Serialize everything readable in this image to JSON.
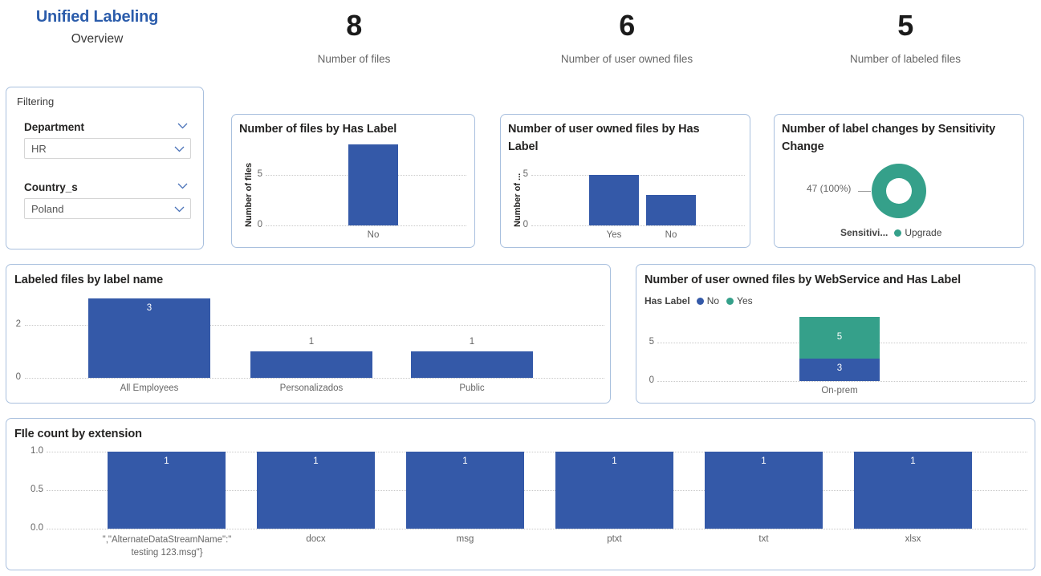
{
  "header": {
    "title": "Unified Labeling",
    "subtitle": "Overview",
    "kpis": [
      {
        "value": "8",
        "label": "Number of files"
      },
      {
        "value": "6",
        "label": "Number of user owned files"
      },
      {
        "value": "5",
        "label": "Number of labeled files"
      }
    ]
  },
  "filtering": {
    "heading": "Filtering",
    "slicers": [
      {
        "label": "Department",
        "value": "HR"
      },
      {
        "label": "Country_s",
        "value": "Poland"
      }
    ]
  },
  "colors": {
    "brand_blue": "#2b5cab",
    "bar_blue": "#3459a8",
    "teal": "#35a08a",
    "card_border": "#a9c0de",
    "gridline": "#c9c9c9",
    "muted_text": "#666666"
  },
  "chart_data": [
    {
      "id": "files_by_has_label",
      "type": "bar",
      "title": "Number of files by Has Label",
      "ylabel": "Number of files",
      "xlabel": "",
      "categories": [
        "No"
      ],
      "values": [
        8
      ],
      "ylim": [
        0,
        9
      ],
      "yticks": [
        "0",
        "5"
      ],
      "ytick_values": [
        0,
        5
      ],
      "grid": true,
      "series_color": "#3459a8",
      "show_data_labels": false
    },
    {
      "id": "user_owned_by_has_label",
      "type": "bar",
      "title": "Number of user owned files by Has Label",
      "ylabel": "Number of ...",
      "xlabel": "",
      "categories": [
        "Yes",
        "No"
      ],
      "values": [
        5,
        3
      ],
      "ylim": [
        0,
        5.6
      ],
      "yticks": [
        "0",
        "5"
      ],
      "ytick_values": [
        0,
        5
      ],
      "grid": true,
      "series_color": "#3459a8",
      "show_data_labels": false
    },
    {
      "id": "label_changes_by_sensitivity",
      "type": "pie",
      "title": "Number of label changes by Sensitivity Change",
      "legend_title": "Sensitivi...",
      "legend_position": "bottom",
      "slices": [
        {
          "name": "Upgrade",
          "value": 47,
          "percent": "100%",
          "label": "47 (100%)",
          "color": "#35a08a"
        }
      ]
    },
    {
      "id": "labeled_files_by_label_name",
      "type": "bar",
      "title": "Labeled files by label name",
      "ylabel": "",
      "xlabel": "",
      "categories": [
        "All Employees",
        "Personalizados",
        "Public"
      ],
      "values": [
        3,
        1,
        1
      ],
      "data_labels": [
        "3",
        "1",
        "1"
      ],
      "ylim": [
        0,
        3.2
      ],
      "yticks": [
        "0",
        "2"
      ],
      "ytick_values": [
        0,
        2
      ],
      "grid": true,
      "series_color": "#3459a8",
      "show_data_labels": true
    },
    {
      "id": "user_owned_by_webservice_has_label",
      "type": "bar",
      "stacked": true,
      "title": "Number of user owned files by WebService and Has Label",
      "legend_title": "Has Label",
      "legend_position": "top",
      "categories": [
        "On-prem"
      ],
      "series": [
        {
          "name": "No",
          "values": [
            3
          ],
          "color": "#3459a8"
        },
        {
          "name": "Yes",
          "values": [
            5
          ],
          "color": "#35a08a"
        }
      ],
      "ylim": [
        0,
        8.5
      ],
      "yticks": [
        "0",
        "5"
      ],
      "ytick_values": [
        0,
        5
      ],
      "grid": true,
      "show_data_labels": true
    },
    {
      "id": "file_count_by_extension",
      "type": "bar",
      "title": "FIle count by extension",
      "ylabel": "",
      "xlabel": "",
      "categories": [
        "\",\"AlternateDataStreamName\":\" testing 123.msg\"}",
        "docx",
        "msg",
        "ptxt",
        "txt",
        "xlsx"
      ],
      "values": [
        1,
        1,
        1,
        1,
        1,
        1
      ],
      "data_labels": [
        "1",
        "1",
        "1",
        "1",
        "1",
        "1"
      ],
      "ylim": [
        0,
        1.0
      ],
      "yticks": [
        "0.0",
        "0.5",
        "1.0"
      ],
      "ytick_values": [
        0,
        0.5,
        1.0
      ],
      "grid": true,
      "series_color": "#3459a8",
      "show_data_labels": true
    }
  ]
}
